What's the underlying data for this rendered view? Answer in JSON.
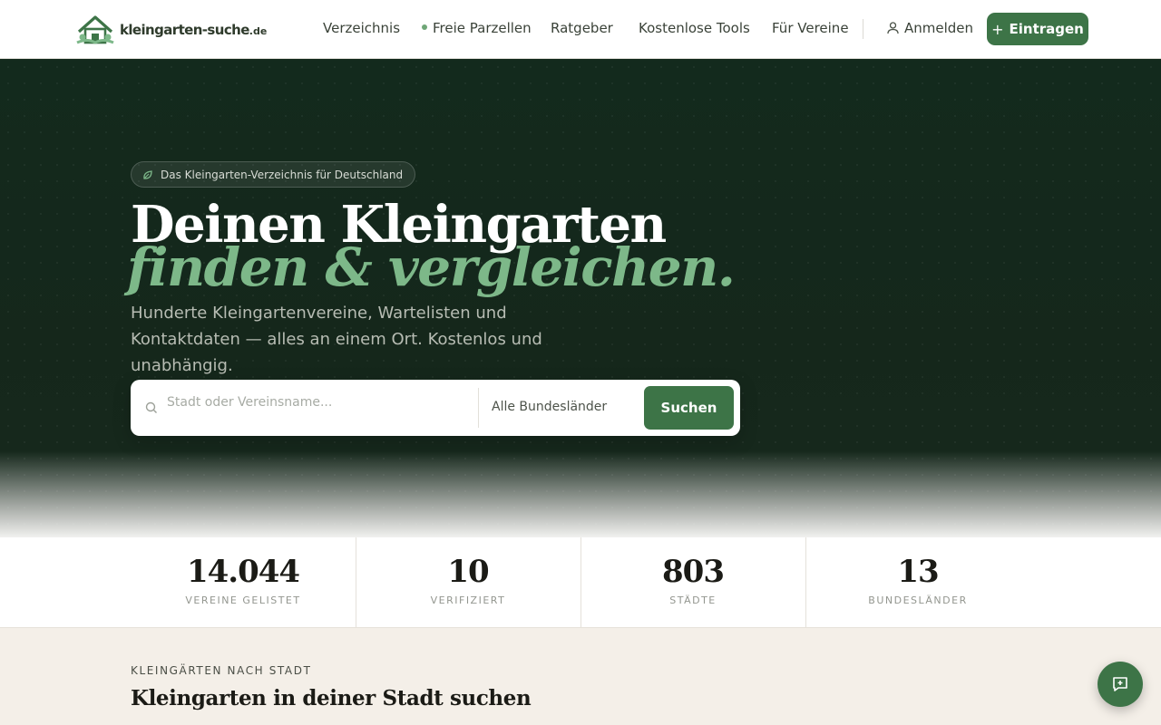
{
  "brand": {
    "name": "kleingarten-suche",
    "tld": ".de",
    "accent": "#3d7447",
    "accent_light": "#7db889",
    "hero_bg": "#132a1d"
  },
  "nav": {
    "items": [
      {
        "label": "Verzeichnis"
      },
      {
        "label": "Freie Parzellen"
      },
      {
        "label": "Ratgeber"
      },
      {
        "label": "Kostenlose Tools"
      },
      {
        "label": "Für Vereine"
      }
    ],
    "login_label": "Anmelden",
    "add_label": "Eintragen"
  },
  "hero": {
    "badge": "Das Kleingarten-Verzeichnis für Deutschland",
    "headline_line1": "Deinen Kleingarten",
    "headline_line2": "finden & vergleichen.",
    "lead": "Hunderte Kleingartenvereine, Wartelisten und Kontaktdaten — alles an einem Ort. Kostenlos und unabhängig."
  },
  "search": {
    "placeholder": "Stadt oder Vereinsname...",
    "state_selected": "Alle Bundesländer",
    "button_label": "Suchen"
  },
  "stats": [
    {
      "value": "14.044",
      "label": "VEREINE GELISTET"
    },
    {
      "value": "10",
      "label": "VERIFIZIERT"
    },
    {
      "value": "803",
      "label": "STÄDTE"
    },
    {
      "value": "13",
      "label": "BUNDESLÄNDER"
    }
  ],
  "section": {
    "kicker": "KLEINGÄRTEN NACH STADT",
    "title": "Kleingarten in deiner Stadt suchen"
  },
  "icons": {
    "logo": "garden-house-icon",
    "badge": "leaf-icon",
    "login": "user-icon",
    "add": "plus-icon",
    "search": "search-icon",
    "fab": "chat-plus-icon"
  }
}
